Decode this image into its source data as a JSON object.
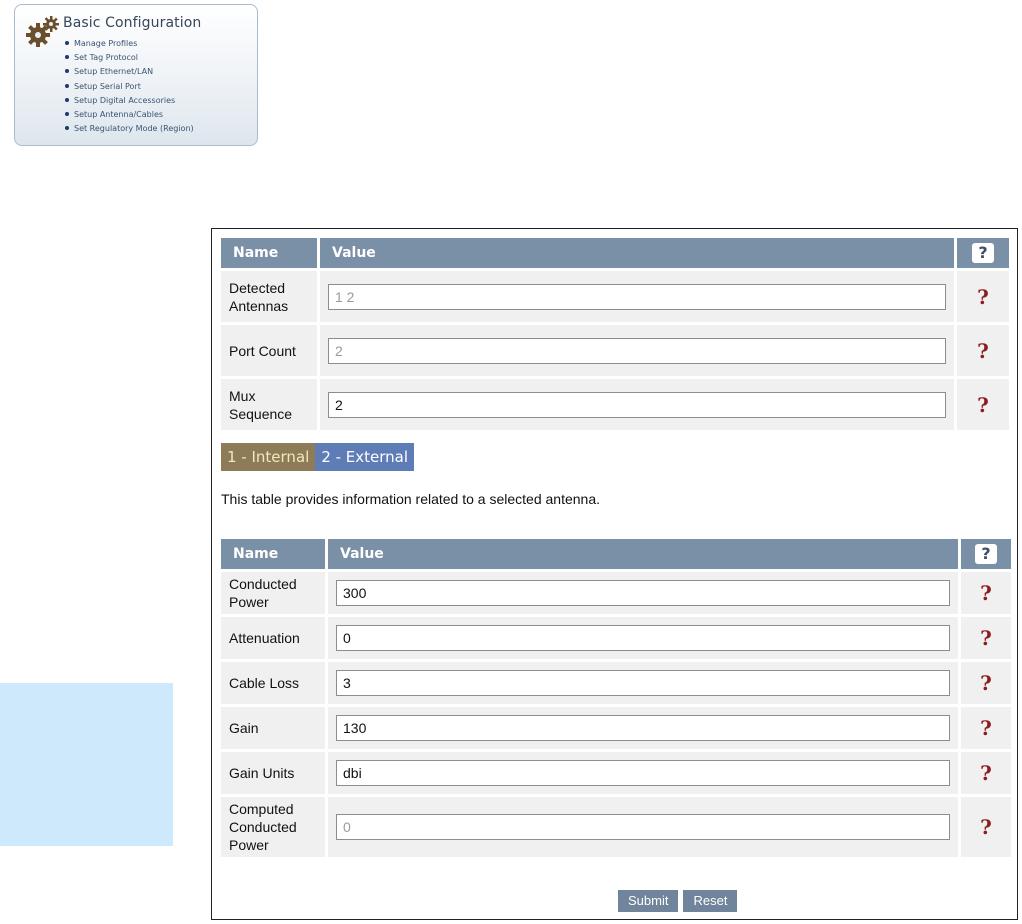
{
  "menu": {
    "title": "Basic Configuration",
    "items": [
      "Manage Profiles",
      "Set Tag Protocol",
      "Setup Ethernet/LAN",
      "Setup Serial Port",
      "Setup Digital Accessories",
      "Setup Antenna/Cables",
      "Set Regulatory Mode (Region)"
    ]
  },
  "reader_table": {
    "headers": {
      "name": "Name",
      "value": "Value",
      "help": "?"
    },
    "rows": [
      {
        "name": "Detected Antennas",
        "value": "1 2",
        "readonly": true
      },
      {
        "name": "Port Count",
        "value": "2",
        "readonly": true
      },
      {
        "name": "Mux Sequence",
        "value": "2",
        "readonly": false
      }
    ]
  },
  "tabs": {
    "tab1": "1 - Internal",
    "tab2": "2 - External",
    "active": "1 - Internal"
  },
  "description": "This table provides information related to a selected antenna.",
  "antenna_table": {
    "headers": {
      "name": "Name",
      "value": "Value",
      "help": "?"
    },
    "rows": [
      {
        "name": "Conducted Power",
        "value": "300",
        "readonly": false
      },
      {
        "name": "Attenuation",
        "value": "0",
        "readonly": false
      },
      {
        "name": "Cable Loss",
        "value": "3",
        "readonly": false
      },
      {
        "name": "Gain",
        "value": "130",
        "readonly": false
      },
      {
        "name": "Gain Units",
        "value": "dbi",
        "readonly": false
      },
      {
        "name": "Computed Conducted Power",
        "value": "0",
        "readonly": true
      }
    ]
  },
  "help_glyph": "?",
  "buttons": {
    "submit": "Submit",
    "reset": "Reset"
  },
  "colors": {
    "header_bg": "#7a90a7",
    "row_bg": "#f0f0f0",
    "help_mark": "#8b1c20",
    "tab_active": "#8e7c58",
    "tab_inactive": "#5e7db7",
    "side_panel": "#cde9fb"
  }
}
